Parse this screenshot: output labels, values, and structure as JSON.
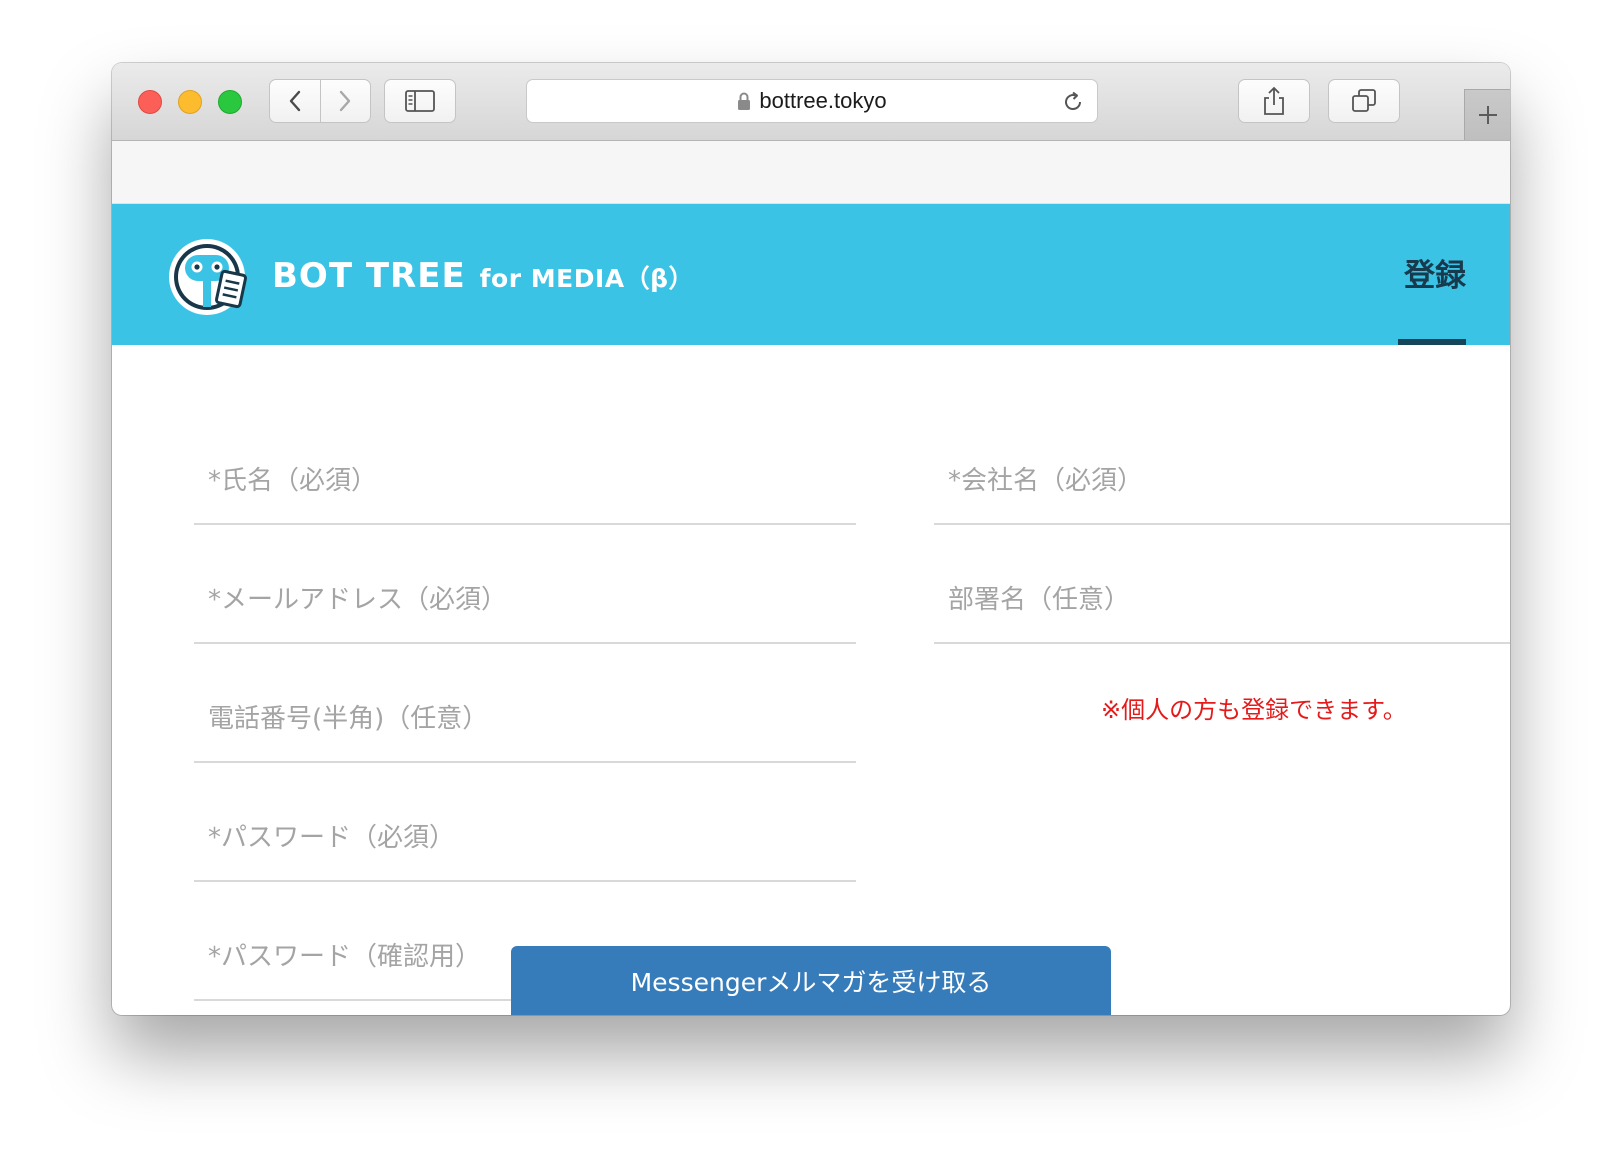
{
  "browser": {
    "url": "bottree.tokyo",
    "icons": {
      "close": "close-traffic-light",
      "minimize": "minimize-traffic-light",
      "zoom": "zoom-traffic-light",
      "back": "chevron-left-icon",
      "forward": "chevron-right-icon",
      "sidebar": "sidebar-icon",
      "lock": "lock-icon",
      "reload": "reload-icon",
      "share": "share-icon",
      "tabs": "tabs-overview-icon",
      "new_tab": "plus-icon"
    }
  },
  "header": {
    "brand_main": "BOT TREE",
    "brand_sub": "for MEDIA（β）",
    "nav_register": "登録",
    "color": "#3bc3e6"
  },
  "form": {
    "left": [
      {
        "placeholder": "*氏名（必須）"
      },
      {
        "placeholder": "*メールアドレス（必須）"
      },
      {
        "placeholder": "電話番号(半角)（任意）"
      },
      {
        "placeholder": "*パスワード（必須）"
      },
      {
        "placeholder": "*パスワード（確認用）"
      }
    ],
    "right": [
      {
        "placeholder": "*会社名（必須）"
      },
      {
        "placeholder": "部署名（任意）"
      }
    ],
    "note": "※個人の方も登録できます。"
  },
  "messenger_button": {
    "label": "Messengerメルマガを受け取る",
    "color": "#377cba"
  }
}
